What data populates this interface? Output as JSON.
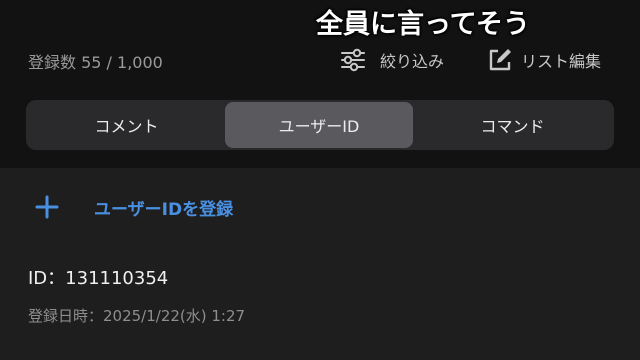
{
  "overlay": {
    "caption": "全員に言ってそう"
  },
  "header": {
    "count_label": "登録数 55 / 1,000",
    "filter_label": "絞り込み",
    "edit_label": "リスト編集"
  },
  "icons": {
    "filter": "sliders-icon",
    "edit": "edit-square-icon",
    "add": "plus-icon"
  },
  "tabs": [
    {
      "label": "コメント",
      "selected": false
    },
    {
      "label": "ユーザーID",
      "selected": true
    },
    {
      "label": "コマンド",
      "selected": false
    }
  ],
  "add_button": {
    "label": "ユーザーIDを登録"
  },
  "entry": {
    "id_label": "ID：131110354",
    "date_label": "登録日時：2025/1/22(水) 1:27"
  },
  "colors": {
    "accent": "#4a90e2",
    "selected_tab": "#5a5a5e",
    "background": "#1e1e1f"
  }
}
